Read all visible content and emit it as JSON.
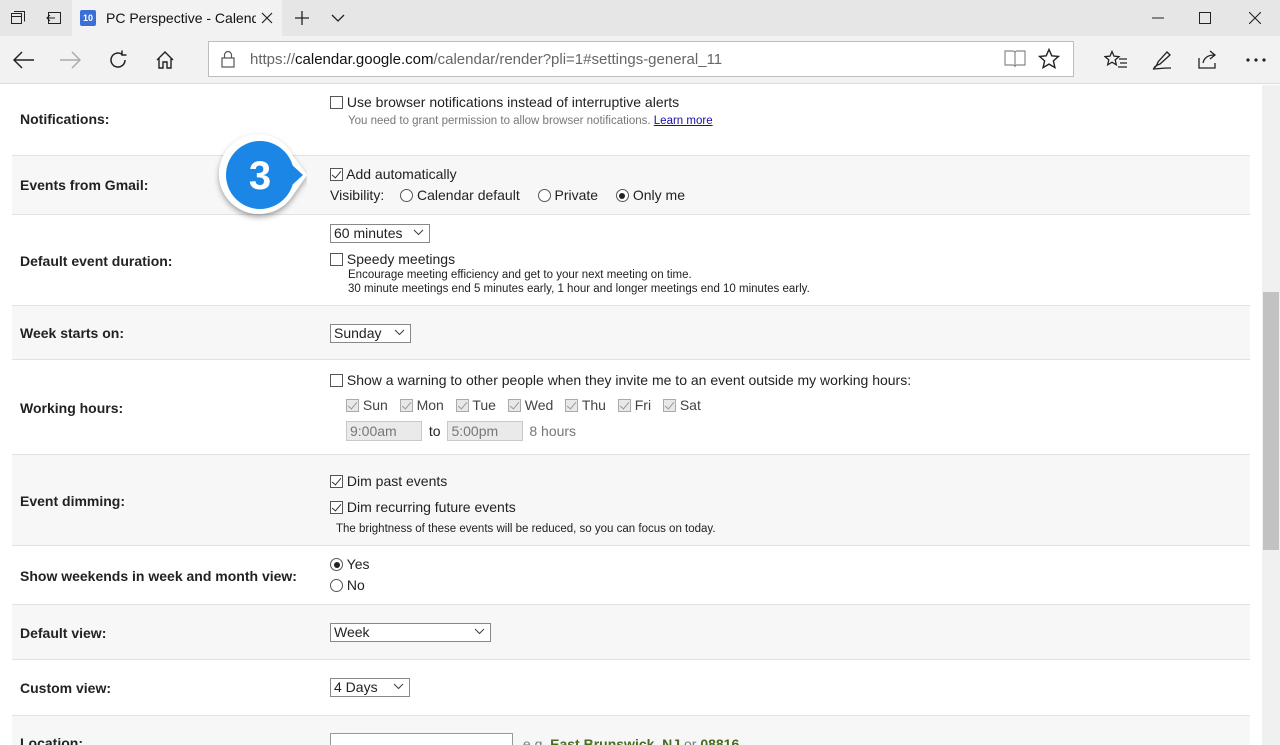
{
  "browser": {
    "tab_title": "PC Perspective - Calend",
    "tab_favicon_text": "10",
    "url_prefix": "https://",
    "url_domain": "calendar.google.com",
    "url_path": "/calendar/render?pli=1#settings-general_11"
  },
  "callout": {
    "number": "3",
    "color": "#1a86e6"
  },
  "settings": {
    "notifications": {
      "label": "Notifications:",
      "option": "Use browser notifications instead of interruptive alerts",
      "hint": "You need to grant permission to allow browser notifications.",
      "link": "Learn more"
    },
    "gmail_events": {
      "label": "Events from Gmail:",
      "option": "Add automatically",
      "visibility_label": "Visibility:",
      "visibility_options": [
        "Calendar default",
        "Private",
        "Only me"
      ],
      "visibility_selected": "Only me"
    },
    "event_duration": {
      "label": "Default event duration:",
      "value": "60 minutes",
      "speedy": "Speedy meetings",
      "speedy_desc1": "Encourage meeting efficiency and get to your next meeting on time.",
      "speedy_desc2": "30 minute meetings end 5 minutes early, 1 hour and longer meetings end 10 minutes early."
    },
    "week_start": {
      "label": "Week starts on:",
      "value": "Sunday"
    },
    "working_hours": {
      "label": "Working hours:",
      "option": "Show a warning to other people when they invite me to an event outside my working hours:",
      "days": [
        "Sun",
        "Mon",
        "Tue",
        "Wed",
        "Thu",
        "Fri",
        "Sat"
      ],
      "start": "9:00am",
      "to": "to",
      "end": "5:00pm",
      "duration": "8 hours"
    },
    "dimming": {
      "label": "Event dimming:",
      "past": "Dim past events",
      "recurring": "Dim recurring future events",
      "desc": "The brightness of these events will be reduced, so you can focus on today."
    },
    "weekends": {
      "label": "Show weekends in week and month view:",
      "yes": "Yes",
      "no": "No"
    },
    "default_view": {
      "label": "Default view:",
      "value": "Week"
    },
    "custom_view": {
      "label": "Custom view:",
      "value": "4 Days"
    },
    "location": {
      "label": "Location:",
      "eg": "e.g.",
      "example1": "East Brunswick, NJ",
      "or": "or",
      "example2": "08816"
    }
  }
}
